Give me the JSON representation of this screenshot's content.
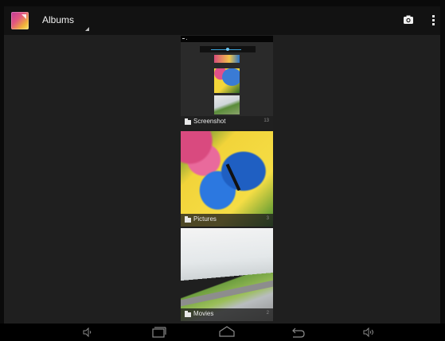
{
  "actionbar": {
    "title": "Albums",
    "app_icon": "gallery-app-icon",
    "actions": [
      {
        "icon": "camera-icon"
      },
      {
        "icon": "overflow-menu-icon"
      }
    ]
  },
  "albums": [
    {
      "name": "Screenshot",
      "count": "13"
    },
    {
      "name": "Pictures",
      "count": "3"
    },
    {
      "name": "Movies",
      "count": "2"
    }
  ],
  "navbar": {
    "buttons": [
      "volume-down-icon",
      "recent-apps-icon",
      "home-icon",
      "back-icon",
      "volume-up-icon"
    ]
  }
}
